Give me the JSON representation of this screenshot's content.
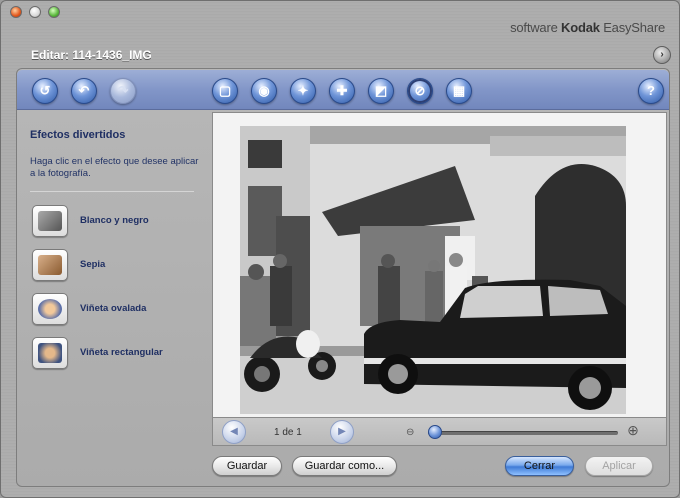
{
  "window": {
    "brand_prefix": "software",
    "brand_name": "Kodak",
    "brand_suffix": "EasyShare",
    "edit_title": "Editar: 114-1436_IMG"
  },
  "toolbar": {
    "buttons": [
      {
        "name": "rotate-left-icon",
        "glyph": "↺"
      },
      {
        "name": "undo-icon",
        "glyph": "↶"
      },
      {
        "name": "redo-icon",
        "glyph": "↷"
      },
      {
        "name": "crop-icon",
        "glyph": "▢"
      },
      {
        "name": "red-eye-icon",
        "glyph": "◉"
      },
      {
        "name": "enhance-icon",
        "glyph": "✦"
      },
      {
        "name": "adjust-icon",
        "glyph": "✚"
      },
      {
        "name": "color-icon",
        "glyph": "◩"
      },
      {
        "name": "fun-effects-icon",
        "glyph": "⊘"
      },
      {
        "name": "scratch-icon",
        "glyph": "▦"
      },
      {
        "name": "help-icon",
        "glyph": "?"
      }
    ]
  },
  "sidebar": {
    "title": "Efectos divertidos",
    "description": "Haga clic en el efecto que desee aplicar a la fotografía.",
    "effects": [
      {
        "label": "Blanco y negro",
        "thumb_color": "#6b6b6b"
      },
      {
        "label": "Sepia",
        "thumb_color": "#9c6b3c"
      },
      {
        "label": "Viñeta ovalada",
        "thumb_color": "#5a6ea8"
      },
      {
        "label": "Viñeta rectangular",
        "thumb_color": "#4e648f"
      }
    ]
  },
  "navigation": {
    "pager": "1 de 1",
    "zoom_level": 0.0
  },
  "buttons": {
    "save": "Guardar",
    "save_as": "Guardar como...",
    "close": "Cerrar",
    "apply": "Aplicar"
  },
  "colors": {
    "accent": "#3f7bd6",
    "toolbar": "#8296c8",
    "label_text": "#1f2f63"
  }
}
